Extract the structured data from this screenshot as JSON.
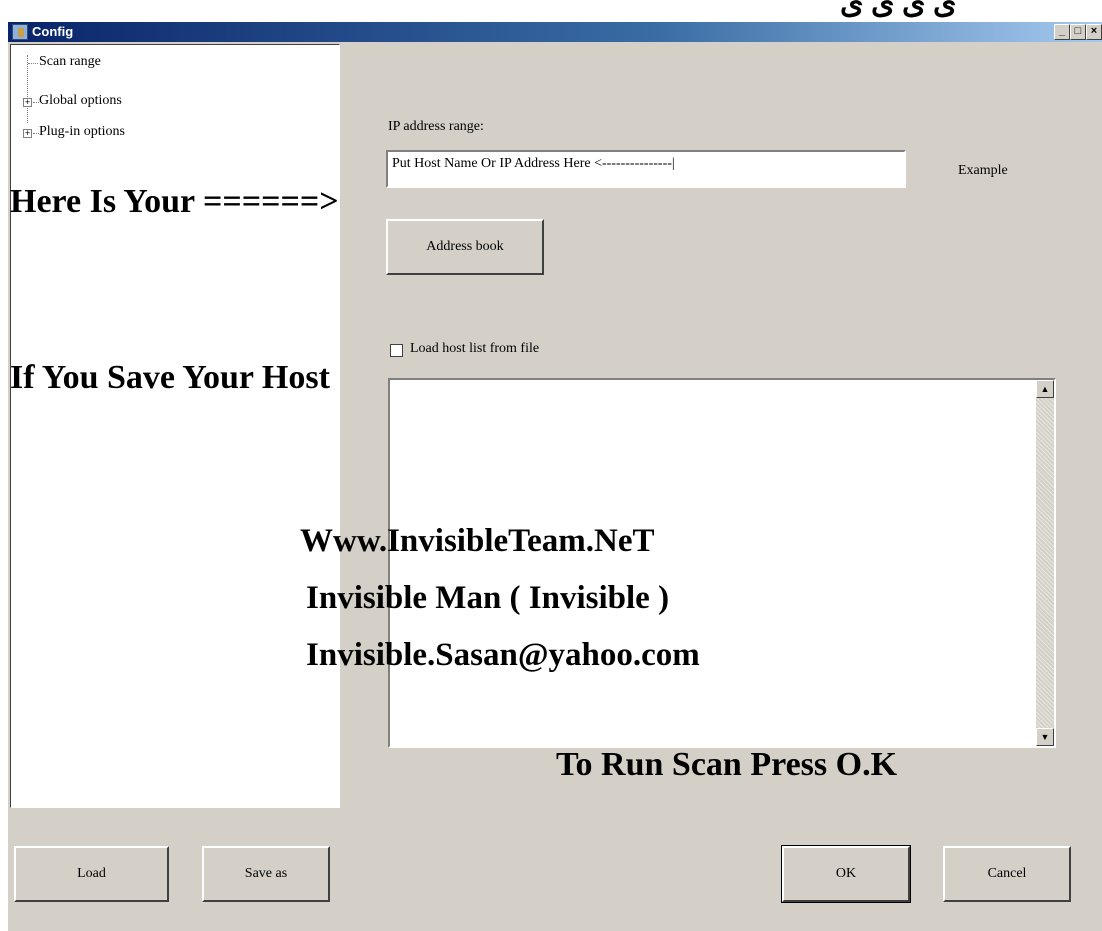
{
  "window": {
    "title": "Config",
    "min_glyph": "_",
    "max_glyph": "□",
    "close_glyph": "×"
  },
  "top_decoration": "ی ی ی ی",
  "tree": {
    "items": [
      {
        "label": "Scan range",
        "expander": ""
      },
      {
        "label": "Global options",
        "expander": "+"
      },
      {
        "label": "Plug-in options",
        "expander": "+"
      }
    ]
  },
  "scan": {
    "ip_label": "IP address range:",
    "ip_value": "Put Host Name Or IP Address Here <---------------|",
    "example_label": "Example",
    "address_book_label": "Address book",
    "load_hosts_label": "Load host list from file",
    "load_hosts_checked": false
  },
  "overlays": {
    "here_is_your": "Here Is Your ======>",
    "if_you_save": "If You Save Your Host",
    "site": "Www.InvisibleTeam.NeT",
    "author": "Invisible Man ( Invisible )",
    "email": "Invisible.Sasan@yahoo.com",
    "run_scan": "To Run Scan Press O.K"
  },
  "footer": {
    "load_label": "Load",
    "save_as_label": "Save as",
    "ok_label": "OK",
    "cancel_label": "Cancel"
  },
  "scrollbar": {
    "up_glyph": "▲",
    "down_glyph": "▼"
  }
}
